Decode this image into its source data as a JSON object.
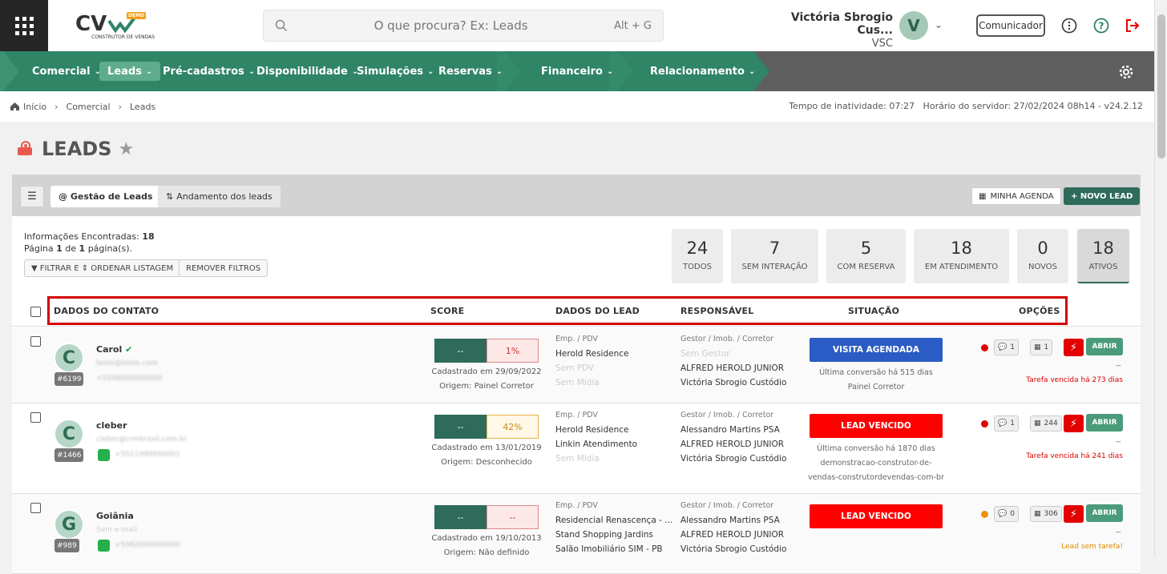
{
  "header": {
    "search_placeholder": "O que procura? Ex: Leads",
    "search_shortcut": "Alt + G",
    "user_name": "Victória Sbrogio Cus...",
    "user_company": "VSC",
    "user_initial": "V",
    "comunicador_label": "Comunicador",
    "logo_badge": "DEMO",
    "logo_sub": "CONSTRUTOR DE VENDAS"
  },
  "nav": {
    "items": [
      "Comercial",
      "Leads",
      "Pré-cadastros",
      "Disponibilidade",
      "Simulações",
      "Reservas",
      "Financeiro",
      "Relacionamento"
    ]
  },
  "breadcrumb": {
    "items": [
      "Início",
      "Comercial",
      "Leads"
    ],
    "right": "Tempo de inatividade: 07:27   Horário do servidor: 27/02/2024 08h14 - v24.2.12"
  },
  "page": {
    "title": "LEADS"
  },
  "toolbar": {
    "tab_gestao": "@ Gestão de Leads",
    "tab_andamento": "Andamento dos leads",
    "minha_agenda": "MINHA AGENDA",
    "novo_lead": "+ NOVO LEAD"
  },
  "info": {
    "encontradas_label": "Informações Encontradas:",
    "encontradas_value": "18",
    "pagina_a": "Página ",
    "pagina_n": "1",
    "pagina_b": " de ",
    "pagina_t": "1",
    "pagina_c": " página(s).",
    "filtrar": "FILTRAR E ⇕ ORDENAR LISTAGEM",
    "remover": "REMOVER FILTROS"
  },
  "stats": [
    {
      "n": "24",
      "l": "TODOS"
    },
    {
      "n": "7",
      "l": "SEM INTERAÇÃO"
    },
    {
      "n": "5",
      "l": "COM RESERVA"
    },
    {
      "n": "18",
      "l": "EM ATENDIMENTO"
    },
    {
      "n": "0",
      "l": "NOVOS"
    },
    {
      "n": "18",
      "l": "ATIVOS"
    }
  ],
  "table": {
    "headers": [
      "DADOS DO CONTATO",
      "SCORE",
      "DADOS DO LEAD",
      "RESPONSÁVEL",
      "SITUAÇÃO",
      "OPÇÕES"
    ]
  },
  "rows": [
    {
      "initial": "C",
      "id": "#6199",
      "name": "Carol",
      "email": "teste@teste.com",
      "phone": "+5548000000000",
      "score_a": "--",
      "score_b": "1%",
      "cadastrado": "Cadastrado em 29/09/2022",
      "origem": "Origem: Painel Corretor",
      "lead_label": "Emp. / PDV",
      "lead_1": "Herold Residence",
      "lead_2": "Sem PDV",
      "lead_3": "Sem Mídia",
      "resp_label": "Gestor / Imob. / Corretor",
      "resp_1": "Sem Gestor",
      "resp_2": "ALFRED HEROLD JUNIOR",
      "resp_3": "Victória Sbrogio Custódio",
      "situacao": "VISITA AGENDADA",
      "sit_1": "Última conversão há 515 dias",
      "sit_2": "Painel Corretor",
      "chat": "1",
      "cal": "1",
      "abrir": "ABRIR",
      "dash": "--",
      "tarefa": "Tarefa vencida há 273 dias"
    },
    {
      "initial": "C",
      "id": "#1466",
      "name": "cleber",
      "email": "cleber@crmbrasil.com.br",
      "phone": "+5511999990001",
      "score_a": "--",
      "score_b": "42%",
      "cadastrado": "Cadastrado em 13/01/2019",
      "origem": "Origem: Desconhecido",
      "lead_label": "Emp. / PDV",
      "lead_1": "Herold Residence",
      "lead_2": "Linkin Atendimento",
      "lead_3": "Sem Mídia",
      "resp_label": "Gestor / Imob. / Corretor",
      "resp_1": "Alessandro Martins PSA",
      "resp_2": "ALFRED HEROLD JUNIOR",
      "resp_3": "Victória Sbrogio Custódio",
      "situacao": "LEAD VENCIDO",
      "sit_1": "Última conversão há 1870 dias",
      "sit_2": "demonstracao-construtor-de-",
      "sit_3": "vendas-construtordevendas-com-br",
      "chat": "1",
      "cal": "244",
      "abrir": "ABRIR",
      "dash": "--",
      "tarefa": "Tarefa vencida há 241 dias"
    },
    {
      "initial": "G",
      "id": "#989",
      "name": "Goiânia",
      "email": "Sem e-mail",
      "phone": "+5562000000000",
      "score_a": "--",
      "score_b": "--",
      "cadastrado": "Cadastrado em 19/10/2013",
      "origem": "Origem: Não definido",
      "lead_label": "Emp. / PDV",
      "lead_1": "Residencial Renascença - ...",
      "lead_2": "Stand Shopping Jardins",
      "lead_3": "Salão Imobiliário SIM - PB",
      "resp_label": "Gestor / Imob. / Corretor",
      "resp_1": "Alessandro Martins PSA",
      "resp_2": "ALFRED HEROLD JUNIOR",
      "resp_3": "Victória Sbrogio Custódio",
      "situacao": "LEAD VENCIDO",
      "chat": "0",
      "cal": "306",
      "abrir": "ABRIR",
      "dash": "--",
      "tarefa": "Lead sem tarefa!"
    }
  ],
  "colors": {
    "nav_green": "#2f8566",
    "primary": "#2e6b5a",
    "visita": "#2b5bc4",
    "vencido": "#ff0000",
    "highlight_box": "#d40000"
  }
}
